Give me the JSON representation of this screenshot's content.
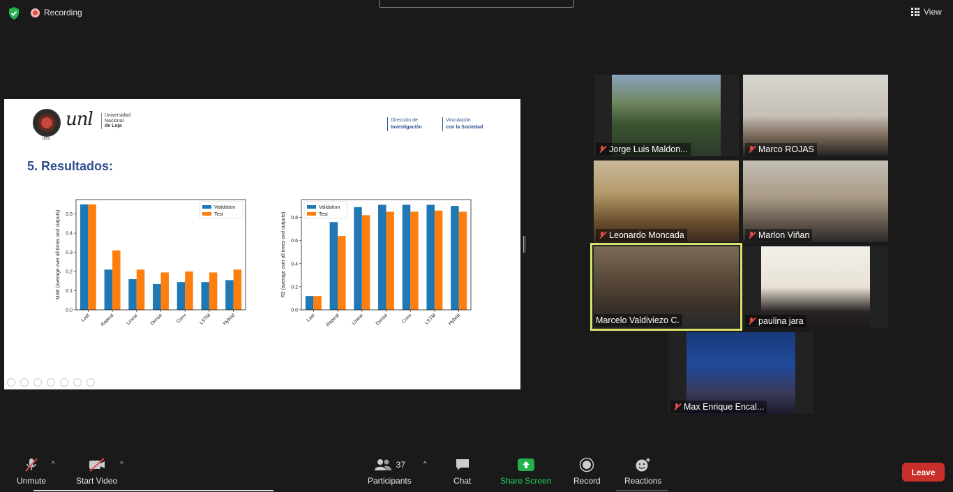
{
  "recording_label": "Recording",
  "view_label": "View",
  "slide": {
    "logo_mark": "unl",
    "logo_year": "1859",
    "university_lines": [
      "Universidad",
      "Nacional",
      "de Loja"
    ],
    "header_links": [
      {
        "line1": "Dirección de",
        "line2": "Investigación"
      },
      {
        "line1": "Vinculación",
        "line2": "con la Sociedad"
      }
    ],
    "title": "5. Resultados:"
  },
  "chart_data": [
    {
      "type": "bar",
      "categories": [
        "Last",
        "Repeat",
        "Linear",
        "Dense",
        "Conv",
        "LSTM",
        "Hybrid"
      ],
      "series": [
        {
          "name": "Validation",
          "values": [
            0.55,
            0.21,
            0.16,
            0.135,
            0.145,
            0.145,
            0.155
          ],
          "color": "#1f77b4"
        },
        {
          "name": "Test",
          "values": [
            0.55,
            0.31,
            0.21,
            0.195,
            0.2,
            0.195,
            0.21
          ],
          "color": "#ff7f0e"
        }
      ],
      "ylabel": "MAE (average over all times and outputs)",
      "ylim": [
        0,
        0.575
      ],
      "yticks": [
        "0.0",
        "0.1",
        "0.2",
        "0.3",
        "0.4",
        "0.5"
      ],
      "legend": "top-right"
    },
    {
      "type": "bar",
      "categories": [
        "Last",
        "Repeat",
        "Linear",
        "Dense",
        "Conv",
        "LSTM",
        "Hybrid"
      ],
      "series": [
        {
          "name": "Validation",
          "values": [
            0.12,
            0.76,
            0.89,
            0.91,
            0.91,
            0.91,
            0.9
          ],
          "color": "#1f77b4"
        },
        {
          "name": "Test",
          "values": [
            0.12,
            0.64,
            0.82,
            0.85,
            0.85,
            0.86,
            0.85
          ],
          "color": "#ff7f0e"
        }
      ],
      "ylabel": "R2 (average over all times and outputs)",
      "ylim": [
        0,
        0.955
      ],
      "yticks": [
        "0.0",
        "0.2",
        "0.4",
        "0.6",
        "0.8"
      ],
      "legend": "top-left"
    }
  ],
  "participants": [
    {
      "name": "Jorge Luis Maldon...",
      "muted": true
    },
    {
      "name": "Marco ROJAS",
      "muted": true
    },
    {
      "name": "Leonardo Moncada",
      "muted": true
    },
    {
      "name": "Marlon Viñan",
      "muted": true
    },
    {
      "name": "Marcelo Valdiviezo C.",
      "muted": false
    },
    {
      "name": "paulina jara",
      "muted": true
    },
    {
      "name": "Max Enrique Encal...",
      "muted": true
    }
  ],
  "toolbar": {
    "unmute": "Unmute",
    "start_video": "Start Video",
    "participants": "Participants",
    "participants_count": "37",
    "chat": "Chat",
    "share_screen": "Share Screen",
    "record": "Record",
    "reactions": "Reactions",
    "leave": "Leave"
  }
}
